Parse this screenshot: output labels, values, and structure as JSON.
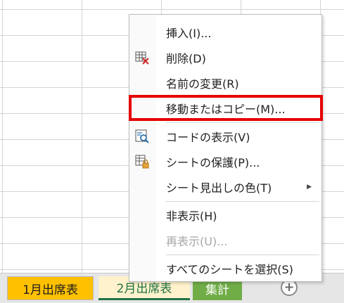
{
  "sheet_tabs": [
    {
      "label": "1月出席表"
    },
    {
      "label": "2月出席表"
    },
    {
      "label": "集計"
    }
  ],
  "add_sheet": {
    "symbol": "+"
  },
  "context_menu": {
    "items": [
      {
        "label": "挿入(I)...",
        "icon": "none",
        "disabled": false
      },
      {
        "label": "削除(D)",
        "icon": "delete-sheet-icon",
        "disabled": false
      },
      {
        "label": "名前の変更(R)",
        "icon": "none",
        "disabled": false
      },
      {
        "label": "移動またはコピー(M)...",
        "icon": "none",
        "disabled": false,
        "highlighted": true
      },
      {
        "label": "コードの表示(V)",
        "icon": "view-code-icon",
        "disabled": false
      },
      {
        "label": "シートの保護(P)...",
        "icon": "protect-sheet-icon",
        "disabled": false
      },
      {
        "label": "シート見出しの色(T)",
        "icon": "none",
        "disabled": false,
        "submenu": true,
        "arrow": "▶"
      },
      {
        "label": "非表示(H)",
        "icon": "none",
        "disabled": false
      },
      {
        "label": "再表示(U)...",
        "icon": "none",
        "disabled": true
      },
      {
        "label": "すべてのシートを選択(S)",
        "icon": "none",
        "disabled": false
      }
    ]
  },
  "colors": {
    "tab1": "#ffc000",
    "tab2": "#fff2cc",
    "tab3": "#70ad47",
    "highlight": "#e60000"
  }
}
